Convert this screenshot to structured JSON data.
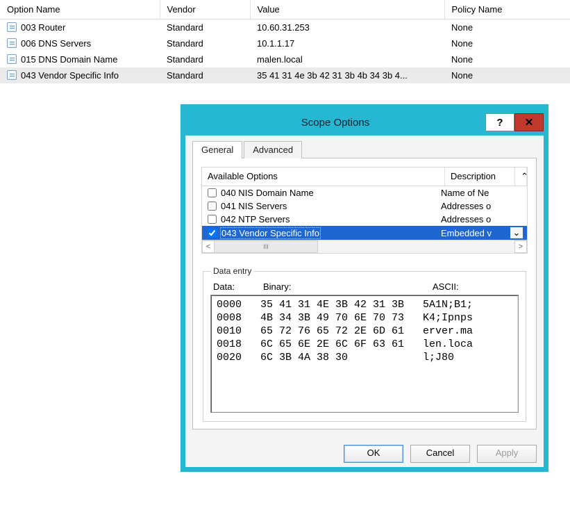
{
  "table": {
    "headers": {
      "option": "Option Name",
      "vendor": "Vendor",
      "value": "Value",
      "policy": "Policy Name"
    },
    "rows": [
      {
        "option": "003 Router",
        "vendor": "Standard",
        "value": "10.60.31.253",
        "policy": "None"
      },
      {
        "option": "006 DNS Servers",
        "vendor": "Standard",
        "value": "10.1.1.17",
        "policy": "None"
      },
      {
        "option": "015 DNS Domain Name",
        "vendor": "Standard",
        "value": "malen.local",
        "policy": "None"
      },
      {
        "option": "043 Vendor Specific Info",
        "vendor": "Standard",
        "value": "35 41 31 4e 3b 42 31 3b 4b 34 3b 4...",
        "policy": "None"
      }
    ]
  },
  "dialog": {
    "title": "Scope Options",
    "help_glyph": "?",
    "close_glyph": "✕",
    "tabs": {
      "general": "General",
      "advanced": "Advanced"
    },
    "available_header": "Available Options",
    "description_header": "Description",
    "up_glyph": "⌃",
    "down_glyph": "⌄",
    "left_glyph": "<",
    "right_glyph": ">",
    "thumb_glyph": "III",
    "options": [
      {
        "checked": false,
        "name": "040 NIS Domain Name",
        "desc": "Name of Ne"
      },
      {
        "checked": false,
        "name": "041 NIS Servers",
        "desc": "Addresses o"
      },
      {
        "checked": false,
        "name": "042 NTP Servers",
        "desc": "Addresses o"
      },
      {
        "checked": true,
        "name": "043 Vendor Specific Info",
        "desc": "Embedded v"
      }
    ],
    "data_entry": {
      "legend": "Data entry",
      "col_data": "Data:",
      "col_binary": "Binary:",
      "col_ascii": "ASCII:",
      "hex": "0000   35 41 31 4E 3B 42 31 3B   5A1N;B1;\n0008   4B 34 3B 49 70 6E 70 73   K4;Ipnps\n0010   65 72 76 65 72 2E 6D 61   erver.ma\n0018   6C 65 6E 2E 6C 6F 63 61   len.loca\n0020   6C 3B 4A 38 30            l;J80"
    },
    "buttons": {
      "ok": "OK",
      "cancel": "Cancel",
      "apply": "Apply"
    }
  }
}
